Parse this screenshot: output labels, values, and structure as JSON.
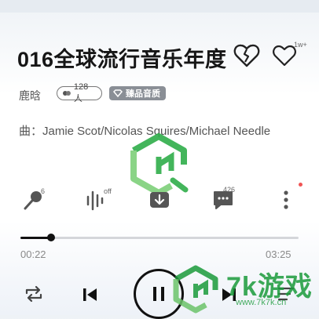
{
  "song": {
    "title": "016全球流行音乐年度",
    "like_count": "1w+",
    "artist": "鹿晗",
    "listeners": "128人",
    "quality_badge": "臻品音质",
    "credits": "曲：Jamie Scot/Nicolas Squires/Michael Needle"
  },
  "actions": {
    "sing_count": "6",
    "effect_label": "off",
    "comment_count": "426"
  },
  "progress": {
    "elapsed": "00:22",
    "total": "03:25",
    "fraction": 0.11
  },
  "watermark": {
    "brand": "7k游戏",
    "url": "www.7k7k.cn"
  },
  "colors": {
    "accent": "#111111",
    "watermark": "#1b9b3b",
    "notification_dot": "#f05454"
  },
  "icons": [
    "broken-heart-icon",
    "heart-icon",
    "microphone-icon",
    "sound-effect-icon",
    "download-icon",
    "comment-icon",
    "more-icon",
    "repeat-icon",
    "previous-icon",
    "pause-icon",
    "next-icon",
    "playlist-icon"
  ]
}
